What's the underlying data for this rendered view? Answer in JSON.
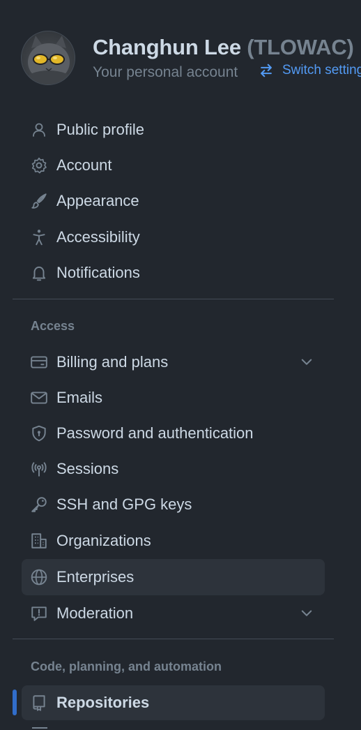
{
  "header": {
    "name": "Changhun Lee",
    "handle": "(TLOWAC)",
    "subtitle": "Your personal account",
    "switch_label": "Switch settings context",
    "avatar_icon": "cat-sunglasses-avatar"
  },
  "nav_top": [
    {
      "label": "Public profile",
      "icon": "person-icon"
    },
    {
      "label": "Account",
      "icon": "gear-icon"
    },
    {
      "label": "Appearance",
      "icon": "paintbrush-icon"
    },
    {
      "label": "Accessibility",
      "icon": "accessibility-icon"
    },
    {
      "label": "Notifications",
      "icon": "bell-icon"
    }
  ],
  "access": {
    "title": "Access",
    "items": [
      {
        "label": "Billing and plans",
        "icon": "credit-card-icon",
        "expandable": true
      },
      {
        "label": "Emails",
        "icon": "mail-icon"
      },
      {
        "label": "Password and authentication",
        "icon": "shield-lock-icon"
      },
      {
        "label": "Sessions",
        "icon": "broadcast-icon"
      },
      {
        "label": "SSH and GPG keys",
        "icon": "key-icon"
      },
      {
        "label": "Organizations",
        "icon": "organization-icon"
      },
      {
        "label": "Enterprises",
        "icon": "globe-icon",
        "highlighted": true
      },
      {
        "label": "Moderation",
        "icon": "report-icon",
        "expandable": true
      }
    ]
  },
  "code": {
    "title": "Code, planning, and automation",
    "items": [
      {
        "label": "Repositories",
        "icon": "repo-icon",
        "active": true
      }
    ]
  },
  "colors": {
    "background": "#22272e",
    "hover": "#2d333b",
    "accent": "#316dca",
    "link": "#539bf5"
  }
}
